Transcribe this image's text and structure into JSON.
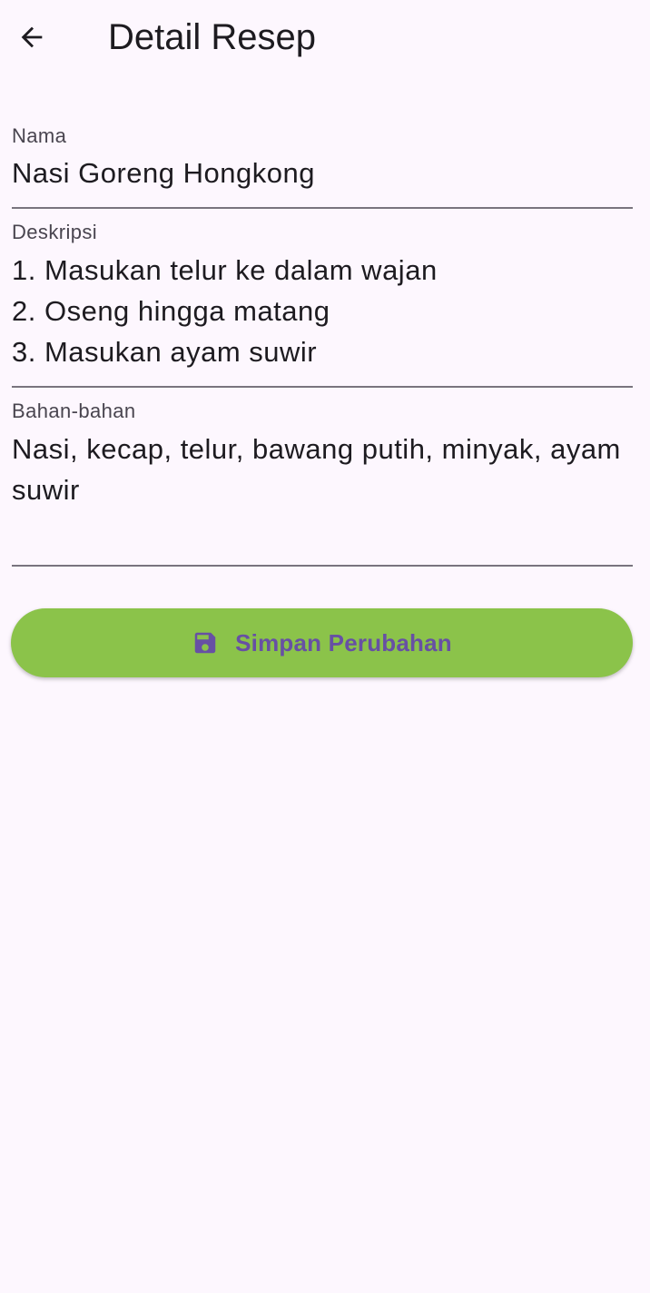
{
  "app_bar": {
    "title": "Detail Resep",
    "back_icon": "arrow-back-icon"
  },
  "form": {
    "nama": {
      "label": "Nama",
      "value": "Nasi Goreng Hongkong"
    },
    "deskripsi": {
      "label": "Deskripsi",
      "value": "1. Masukan telur ke dalam wajan\n2. Oseng hingga matang\n3. Masukan ayam suwir"
    },
    "bahan": {
      "label": "Bahan-bahan",
      "value": "Nasi, kecap, telur, bawang putih, minyak, ayam suwir"
    }
  },
  "save_button": {
    "label": "Simpan Perubahan",
    "icon": "save-icon"
  },
  "colors": {
    "background": "#fdf7fe",
    "button": "#8bc34a",
    "button_text": "#6750a4",
    "underline": "#79747e"
  }
}
